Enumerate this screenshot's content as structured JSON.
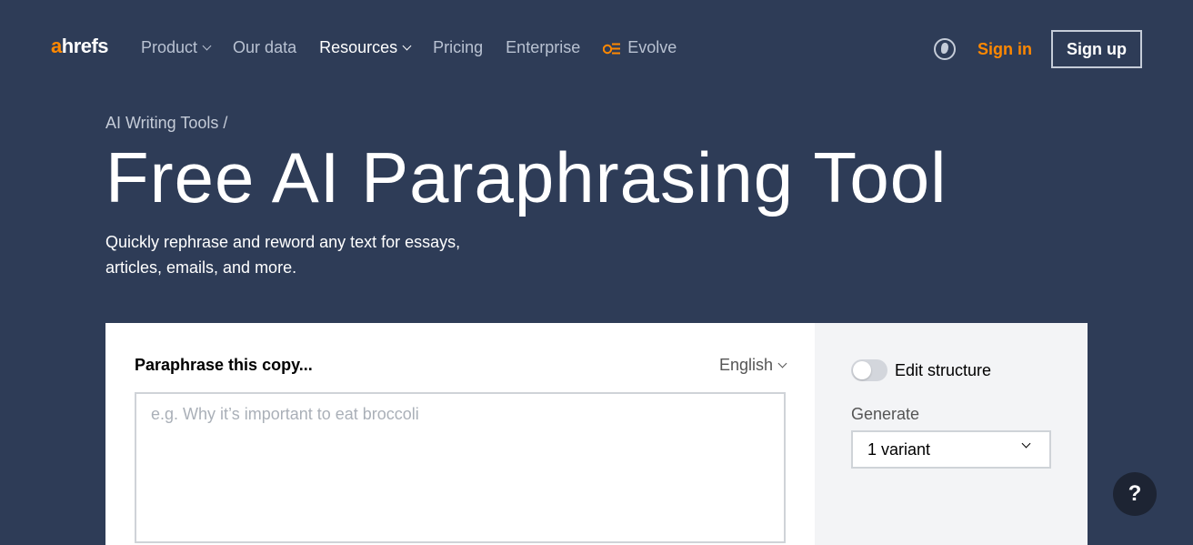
{
  "nav": {
    "logo_a": "a",
    "logo_rest": "hrefs",
    "items": [
      {
        "label": "Product"
      },
      {
        "label": "Our data"
      },
      {
        "label": "Resources"
      },
      {
        "label": "Pricing"
      },
      {
        "label": "Enterprise"
      },
      {
        "label": "Evolve"
      }
    ],
    "sign_in": "Sign in",
    "sign_up": "Sign up"
  },
  "hero": {
    "breadcrumb": "AI Writing Tools",
    "breadcrumb_sep": " /",
    "title": "Free AI Paraphrasing Tool",
    "subtitle": "Quickly rephrase and reword any text for essays, articles, emails, and more."
  },
  "tool": {
    "label": "Paraphrase this copy...",
    "language": "English",
    "placeholder": "e.g. Why it’s important to eat broccoli",
    "edit_structure": "Edit structure",
    "edit_structure_on": false,
    "generate_label": "Generate",
    "generate_value": "1 variant"
  },
  "help": "?",
  "colors": {
    "background": "#2e3c57",
    "accent": "#ff8800"
  }
}
